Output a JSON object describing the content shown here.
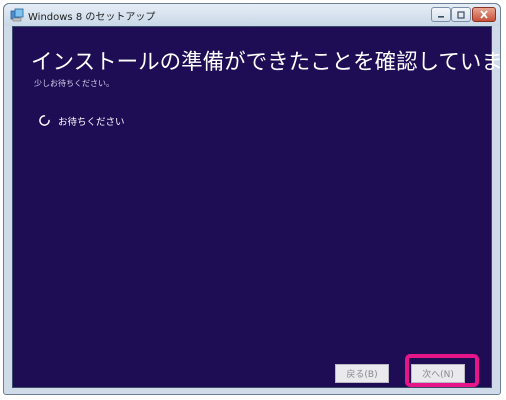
{
  "window": {
    "title": "Windows 8 のセットアップ",
    "icon": "setup-app-icon",
    "controls": [
      "minimize-icon",
      "maximize-icon",
      "close-icon"
    ]
  },
  "main": {
    "heading": "インストールの準備ができたことを確認しています",
    "subtext": "少しお待ちください。",
    "status": {
      "icon": "loading-spinner-icon",
      "text": "お待ちください"
    }
  },
  "footer": {
    "back_label": "戻る(B)",
    "next_label": "次へ(N)",
    "back_enabled": false,
    "next_enabled": false
  },
  "colors": {
    "background": "#1e0c55",
    "heading_text": "#ffffff",
    "highlight": "#e6158a",
    "button_bg": "#e9e9ee",
    "button_text_disabled": "#8a8a8a"
  }
}
